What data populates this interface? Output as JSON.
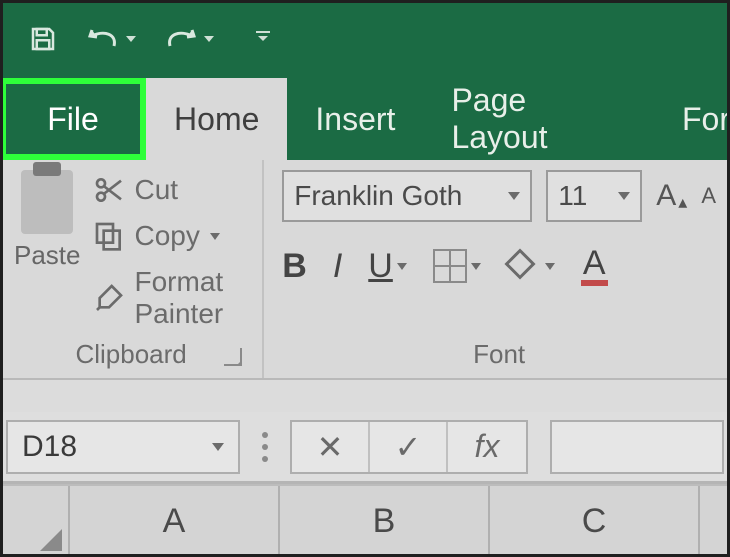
{
  "qat": {
    "save": "save-icon",
    "undo": "undo-icon",
    "redo": "redo-icon",
    "customize": "customize-icon"
  },
  "tabs": {
    "file": "File",
    "home": "Home",
    "insert": "Insert",
    "page_layout": "Page Layout",
    "formulas_partial": "For"
  },
  "ribbon": {
    "clipboard": {
      "paste": "Paste",
      "cut": "Cut",
      "copy": "Copy",
      "format_painter": "Format Painter",
      "group_label": "Clipboard"
    },
    "font": {
      "font_name": "Franklin Goth",
      "font_size": "11",
      "increase": "A",
      "increase_small": "A",
      "decrease": "A",
      "bold": "B",
      "italic": "I",
      "underline": "U",
      "fontcolor_glyph": "A",
      "group_label": "Font"
    }
  },
  "formula_bar": {
    "name_box": "D18",
    "cancel": "✕",
    "enter": "✓",
    "fx": "fx"
  },
  "columns": [
    "A",
    "B",
    "C"
  ]
}
